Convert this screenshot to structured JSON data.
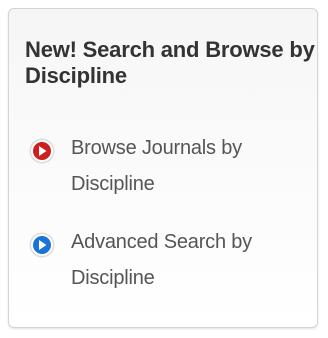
{
  "panel": {
    "title": "New! Search and Browse by Discipline",
    "links": [
      {
        "label": "Browse Journals by Discipline",
        "icon": "red-circle-arrow-icon",
        "icon_color": "#cc1f1f"
      },
      {
        "label": "Advanced Search by Discipline",
        "icon": "blue-circle-arrow-icon",
        "icon_color": "#1a73d6"
      }
    ]
  }
}
